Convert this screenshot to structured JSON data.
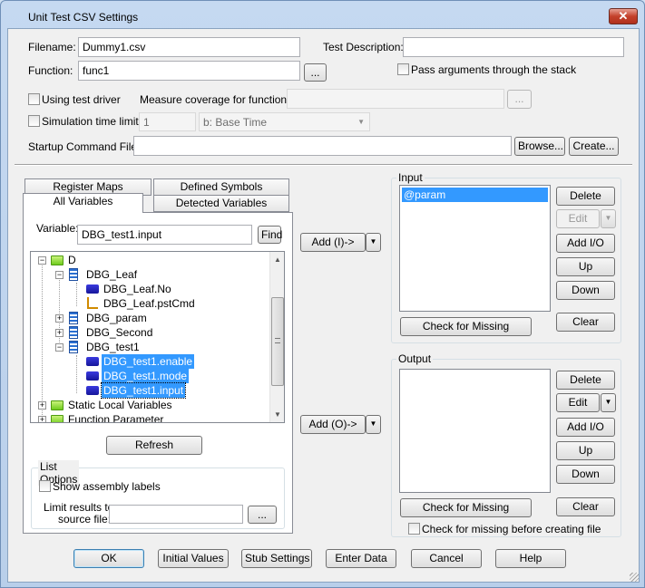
{
  "window": {
    "title": "Unit Test CSV Settings",
    "close_label": "✕"
  },
  "top": {
    "filename_label": "Filename:",
    "filename_value": "Dummy1.csv",
    "test_description_label": "Test Description:",
    "test_description_value": "",
    "function_label": "Function:",
    "function_value": "func1",
    "function_browse_label": "...",
    "pass_args_label": "Pass arguments through the stack",
    "using_test_driver_label": "Using test driver",
    "measure_coverage_label": "Measure coverage for function:",
    "measure_coverage_value": "",
    "measure_browse_label": "...",
    "sim_time_limit_label": "Simulation time limit",
    "sim_time_value": "1",
    "time_base_value": "b: Base Time",
    "startup_cmd_label": "Startup Command File:",
    "startup_cmd_value": "",
    "browse_label": "Browse...",
    "create_label": "Create..."
  },
  "tabs": {
    "register_maps": "Register Maps",
    "defined_symbols": "Defined Symbols",
    "all_variables": "All Variables",
    "detected_variables": "Detected Variables"
  },
  "variables": {
    "variable_label": "Variable:",
    "variable_value": "DBG_test1.input",
    "find_label": "Find",
    "tree": [
      {
        "text": "D",
        "icon": "folder-icon"
      },
      {
        "text": "DBG_Leaf",
        "icon": "struct-icon"
      },
      {
        "text": "DBG_Leaf.No",
        "icon": "variable-icon"
      },
      {
        "text": "DBG_Leaf.pstCmd",
        "icon": "pointer-icon"
      },
      {
        "text": "DBG_param",
        "icon": "struct-icon"
      },
      {
        "text": "DBG_Second",
        "icon": "struct-icon"
      },
      {
        "text": "DBG_test1",
        "icon": "struct-icon"
      },
      {
        "text": "DBG_test1.enable",
        "icon": "variable-icon"
      },
      {
        "text": "DBG_test1.mode",
        "icon": "variable-icon"
      },
      {
        "text": "DBG_test1.input",
        "icon": "variable-icon"
      },
      {
        "text": "Static Local Variables",
        "icon": "folder-icon"
      },
      {
        "text": "Function Parameter",
        "icon": "folder-icon"
      }
    ],
    "refresh_label": "Refresh"
  },
  "list_options": {
    "group_label": "List Options",
    "show_assembly_label": "Show assembly labels",
    "limit_results_label_1": "Limit results to",
    "limit_results_label_2": "source file:",
    "limit_value": "",
    "limit_browse_label": "..."
  },
  "add_input_label": "Add (I)->",
  "add_output_label": "Add (O)->",
  "input": {
    "group_label": "Input",
    "items": [
      "@param"
    ],
    "delete_label": "Delete",
    "edit_label": "Edit",
    "add_io_label": "Add I/O",
    "up_label": "Up",
    "down_label": "Down",
    "check_missing_label": "Check for Missing",
    "clear_label": "Clear"
  },
  "output": {
    "group_label": "Output",
    "items": [],
    "delete_label": "Delete",
    "edit_label": "Edit",
    "add_io_label": "Add I/O",
    "up_label": "Up",
    "down_label": "Down",
    "check_missing_label": "Check for Missing",
    "clear_label": "Clear",
    "check_before_create_label": "Check for missing before creating file"
  },
  "footer": {
    "ok": "OK",
    "initial_values": "Initial Values",
    "stub_settings": "Stub Settings",
    "enter_data": "Enter Data",
    "cancel": "Cancel",
    "help": "Help"
  }
}
